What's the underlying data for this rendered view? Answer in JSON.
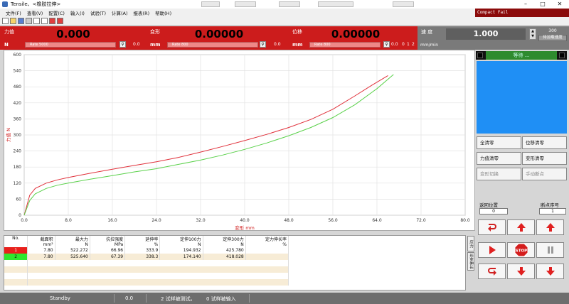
{
  "window": {
    "app_title": "Tensile、<橡胶拉伸>",
    "minimize": "–",
    "maximize": "□",
    "close": "✕"
  },
  "menu": [
    "文件(F)",
    "查看(V)",
    "配置(C)",
    "输入(I)",
    "试验(T)",
    "计算(A)",
    "报表(R)",
    "帮助(H)"
  ],
  "brand": "Compact Fail",
  "toolbar_icons": [
    "new-icon",
    "open-icon",
    "save-icon",
    "print-icon",
    "rect-icon",
    "chart-icon",
    "export-icon",
    "exit-icon"
  ],
  "force_panel": {
    "label": "力值",
    "unit": "N",
    "value": "0.000",
    "scale": "Rate           5000",
    "small": "0.0"
  },
  "deform_panel": {
    "label": "变形",
    "unit": "mm",
    "value": "0.00000",
    "scale": "Rate           800",
    "small": "0.0"
  },
  "disp_panel": {
    "label": "位移",
    "unit": "mm",
    "value": "0.00000",
    "scale": "Rate           800",
    "small": "0.0",
    "marks": [
      "0",
      "1",
      "2"
    ]
  },
  "speed_panel": {
    "label": "速    度",
    "unit": "mm/min",
    "value": "1.000",
    "set_value": "300",
    "set_label": "待加载速度"
  },
  "right_panel": {
    "status": "等待 ...",
    "buttons": [
      "全清零",
      "位移清零",
      "力值清零",
      "变形清零",
      "变形切换",
      "手动断点"
    ],
    "return_label": "返回位置",
    "return_value": "0",
    "break_label": "断点序号",
    "break_value": "1",
    "stop": "STOP"
  },
  "chart_data": {
    "type": "line",
    "xlabel": "变形    mm",
    "ylabel": "力值    N",
    "xlim": [
      0,
      80
    ],
    "ylim": [
      0,
      600
    ],
    "x_ticks": [
      "0.0",
      "8.0",
      "16.0",
      "24.0",
      "32.0",
      "40.0",
      "48.0",
      "56.0",
      "64.0",
      "72.0",
      "80.0"
    ],
    "y_ticks": [
      "0",
      "60",
      "120",
      "180",
      "240",
      "300",
      "360",
      "420",
      "480",
      "540",
      "600"
    ],
    "grid": true,
    "series": [
      {
        "color": "#e0303a",
        "x": [
          0,
          1,
          2,
          4,
          6,
          8,
          12,
          16,
          20,
          24,
          28,
          32,
          36,
          40,
          44,
          48,
          52,
          56,
          60,
          63,
          66
        ],
        "y": [
          0,
          75,
          100,
          120,
          132,
          141,
          157,
          172,
          186,
          200,
          216,
          236,
          257,
          279,
          302,
          328,
          358,
          396,
          446,
          485,
          522
        ]
      },
      {
        "color": "#5ad14a",
        "x": [
          0,
          1,
          2,
          4,
          6,
          8,
          12,
          16,
          20,
          24,
          28,
          32,
          36,
          40,
          44,
          48,
          52,
          56,
          60,
          64,
          67
        ],
        "y": [
          0,
          55,
          80,
          100,
          112,
          120,
          135,
          148,
          162,
          174,
          190,
          206,
          225,
          246,
          270,
          297,
          328,
          365,
          413,
          473,
          526
        ]
      }
    ]
  },
  "table": {
    "headers": [
      "No.",
      "截面积\nmm²",
      "最大力\nN",
      "抗拉强度\nMPa",
      "延伸率\n%",
      "定伸100力\nN",
      "定伸300力\nN",
      "定力伸长率\n%"
    ],
    "rows": [
      {
        "no": "1",
        "color": "#e8201c",
        "cells": [
          "7.80",
          "522.272",
          "66.96",
          "333.9",
          "194.932",
          "425.780",
          ""
        ]
      },
      {
        "no": "2",
        "color": "#2ee82e",
        "cells": [
          "7.80",
          "525.640",
          "67.39",
          "338.3",
          "174.140",
          "418.028",
          ""
        ]
      }
    ],
    "side_tabs": [
      "应力",
      "形变伸长"
    ]
  },
  "status": {
    "state": "Standby",
    "value": "0.0",
    "msg1": "2  试样被测试。",
    "msg2": "0  试样被输入"
  }
}
